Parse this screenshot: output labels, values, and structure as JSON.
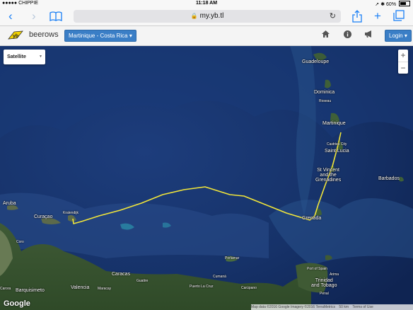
{
  "status_bar": {
    "carrier": "●●●●● CHIPPIE",
    "wifi_icon": "wifi-icon",
    "time": "11:18 AM",
    "battery": "60%",
    "location_icon": "➚",
    "bluetooth_icon": "✱"
  },
  "browser": {
    "domain": "my.yb.tl",
    "lock_icon": "🔒",
    "reload_icon": "↻"
  },
  "header": {
    "brand": "beerows",
    "race_selector": "Martinique - Costa Rica",
    "login": "Login"
  },
  "map": {
    "map_type": "Satellite",
    "zoom_in": "+",
    "zoom_out": "−",
    "google_logo": "Google",
    "attribution": {
      "data": "Map data ©2016 Google Imagery ©2016 TerraMetrics",
      "scale": "50 km",
      "terms": "Terms of Use"
    },
    "places": {
      "guadeloupe": "Guadeloupe",
      "dominica": "Dominica",
      "roseau": "Roseau",
      "martinique": "Martinique",
      "castries": "Castries City",
      "saint_lucia": "Saint Lucia",
      "st_vincent_1": "St Vincent",
      "st_vincent_2": "and the",
      "st_vincent_3": "Grenadines",
      "barbados": "Barbados",
      "grenada": "Grenada",
      "aruba": "Aruba",
      "curacao": "Curaçao",
      "kralendijk": "Kralendijk",
      "coro": "Coro",
      "porlamar": "Porlamar",
      "caracas": "Caracas",
      "guatire": "Guatire",
      "cumana": "Cumaná",
      "puerto_la_cruz": "Puerto La Cruz",
      "carupano": "Carúpano",
      "valencia": "Valencia",
      "maracay": "Maracay",
      "barquisimeto": "Barquisimeto",
      "carora": "Carora",
      "port_of_spain": "Port of Spain",
      "arima": "Arima",
      "trinidad_1": "Trinidad",
      "trinidad_2": "and Tobago",
      "penal": "Penal"
    }
  }
}
